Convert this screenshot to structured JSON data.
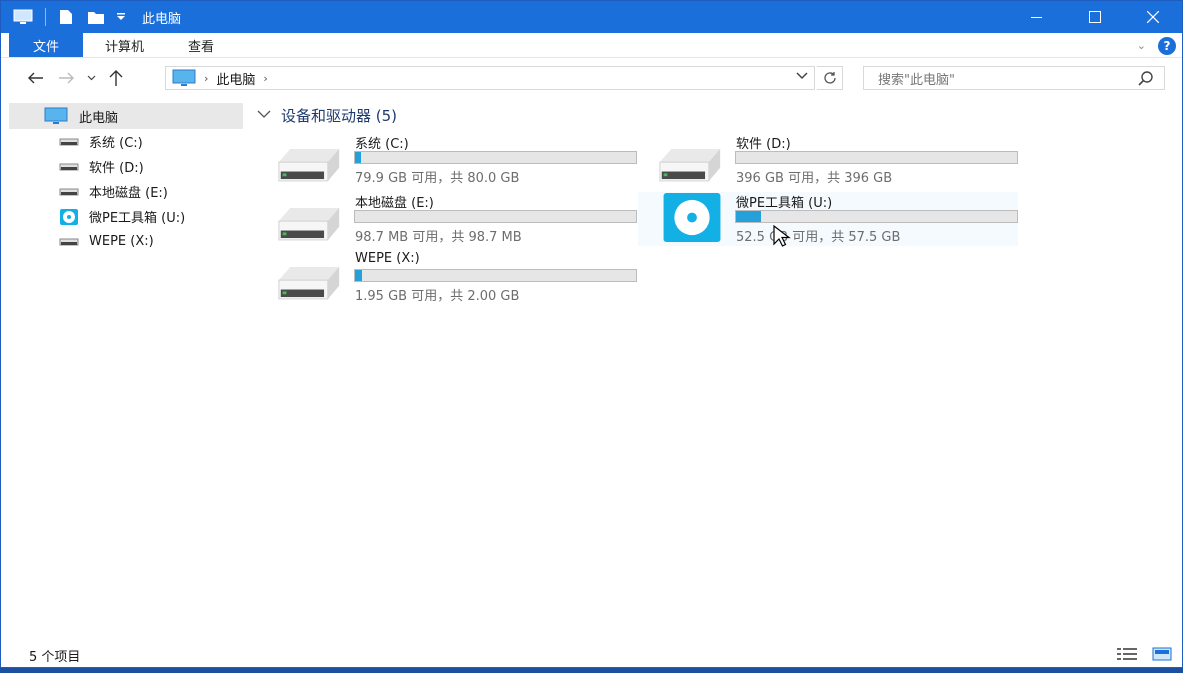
{
  "window": {
    "title": "此电脑"
  },
  "ribbon": {
    "tabs": [
      "文件",
      "计算机",
      "查看"
    ]
  },
  "address": {
    "crumb": "此电脑",
    "search_placeholder": "搜索\"此电脑\""
  },
  "sidebar": {
    "root": "此电脑",
    "items": [
      {
        "label": "系统 (C:)",
        "icon": "hdd-icon"
      },
      {
        "label": "软件 (D:)",
        "icon": "hdd-icon"
      },
      {
        "label": "本地磁盘 (E:)",
        "icon": "hdd-icon"
      },
      {
        "label": "微PE工具箱 (U:)",
        "icon": "disc-icon"
      },
      {
        "label": "WEPE (X:)",
        "icon": "hdd-icon"
      }
    ]
  },
  "main": {
    "group_title": "设备和驱动器 (5)",
    "drives": [
      {
        "name": "系统 (C:)",
        "info": "79.9 GB 可用，共 80.0 GB",
        "used_fraction": 0.001,
        "icon": "hdd-icon"
      },
      {
        "name": "软件 (D:)",
        "info": "396 GB 可用，共 396 GB",
        "used_fraction": 0.0,
        "icon": "hdd-icon"
      },
      {
        "name": "本地磁盘 (E:)",
        "info": "98.7 MB 可用，共 98.7 MB",
        "used_fraction": 0.0,
        "icon": "hdd-icon"
      },
      {
        "name": "微PE工具箱 (U:)",
        "info": "52.5 GB 可用，共 57.5 GB",
        "used_fraction": 0.09,
        "icon": "disc-icon"
      },
      {
        "name": "WEPE (X:)",
        "info": "1.95 GB 可用，共 2.00 GB",
        "used_fraction": 0.025,
        "icon": "hdd-icon"
      }
    ]
  },
  "status": {
    "count": "5 个项目"
  },
  "colors": {
    "accent": "#1a6fdb",
    "bar_fill": "#26a0da"
  }
}
